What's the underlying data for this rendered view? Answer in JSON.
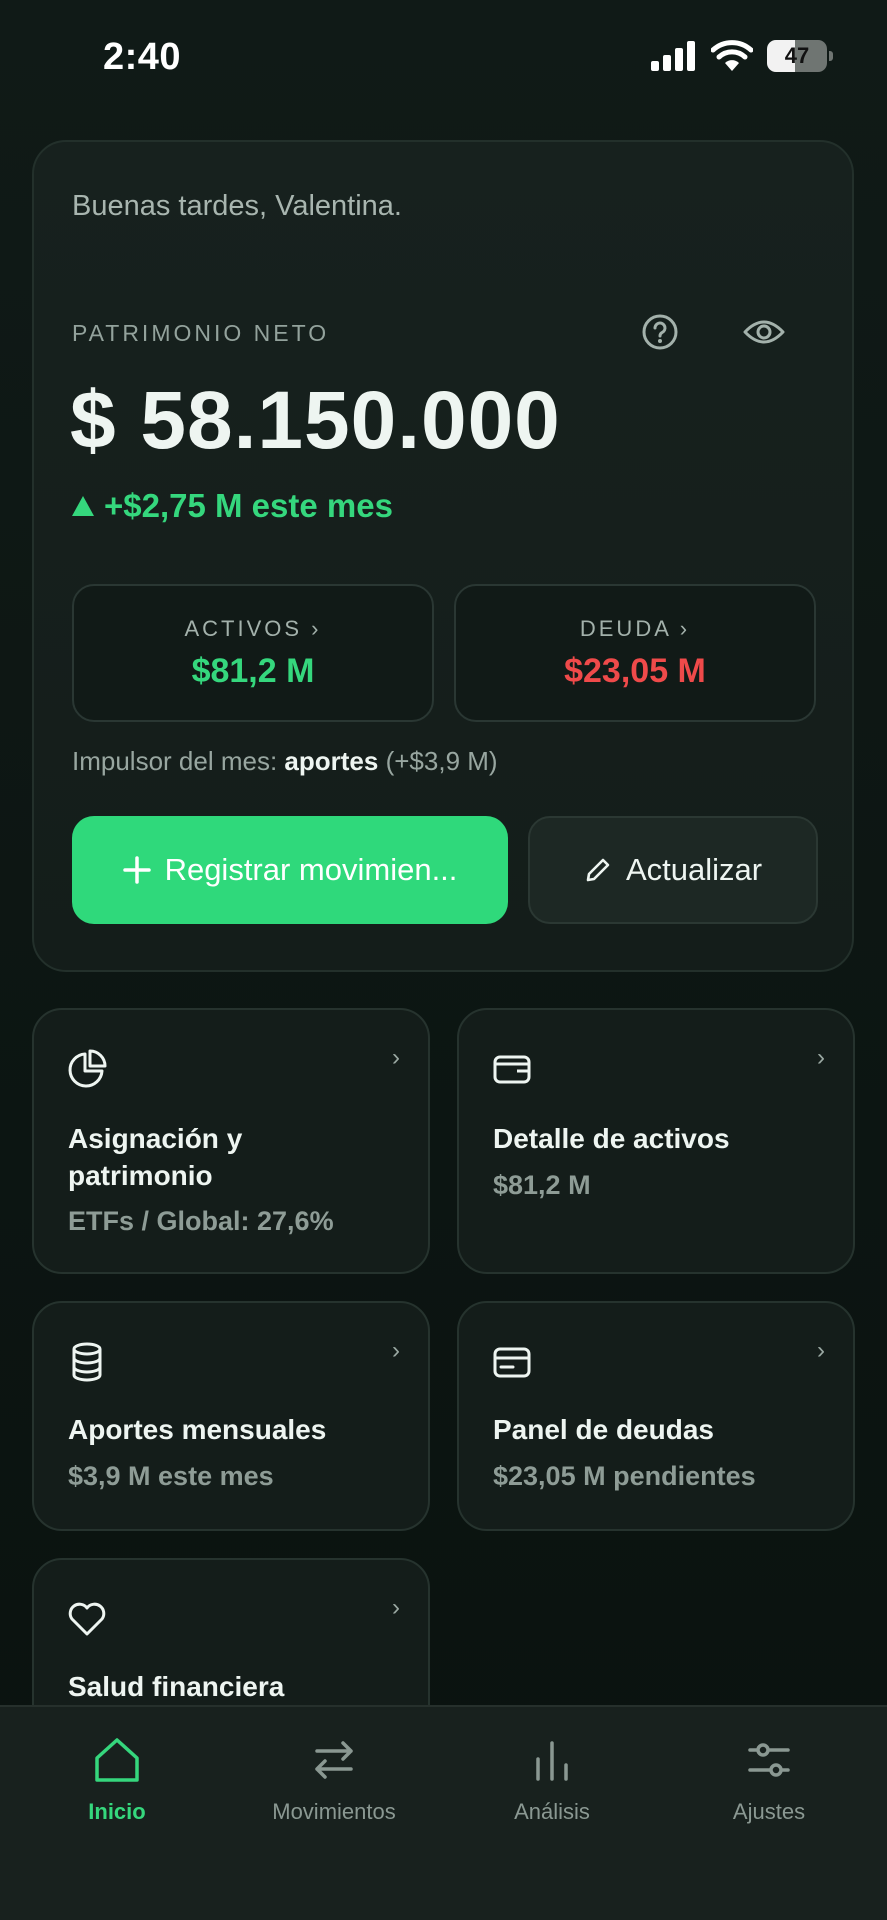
{
  "status_bar": {
    "time": "2:40",
    "battery": "47"
  },
  "hero": {
    "greeting": "Buenas tardes, Valentina.",
    "net_worth_label": "PATRIMONIO NETO",
    "net_worth_value": "$ 58.150.000",
    "monthly_change": "+$2,75 M este mes",
    "assets": {
      "label": "ACTIVOS ›",
      "value": "$81,2 M"
    },
    "debt": {
      "label": "DEUDA ›",
      "value": "$23,05 M"
    },
    "driver_prefix": "Impulsor del mes:",
    "driver_name": "aportes",
    "driver_amount": "(+$3,9 M)",
    "primary_button": "Registrar movimien...",
    "secondary_button": "Actualizar"
  },
  "tiles": [
    {
      "title_line1": "Asignación y",
      "title_line2": "patrimonio",
      "subtitle": "ETFs / Global: 27,6%",
      "icon": "pie-chart-icon"
    },
    {
      "title_line1": "Detalle de activos",
      "subtitle": "$81,2 M",
      "icon": "wallet-icon"
    },
    {
      "title_line1": "Aportes mensuales",
      "subtitle": "$3,9 M este mes",
      "icon": "database-icon"
    },
    {
      "title_line1": "Panel de deudas",
      "subtitle": "$23,05 M pendientes",
      "icon": "credit-card-icon"
    },
    {
      "title_line1": "Salud financiera",
      "icon": "heart-icon"
    }
  ],
  "nav": [
    {
      "label": "Inicio",
      "icon": "home-icon",
      "active": true
    },
    {
      "label": "Movimientos",
      "icon": "transfer-icon"
    },
    {
      "label": "Análisis",
      "icon": "bar-chart-icon"
    },
    {
      "label": "Ajustes",
      "icon": "sliders-icon"
    }
  ],
  "colors": {
    "accent": "#2fd97b",
    "positive": "#35d77d",
    "negative": "#ef4a4a",
    "background": "#0e1613"
  }
}
